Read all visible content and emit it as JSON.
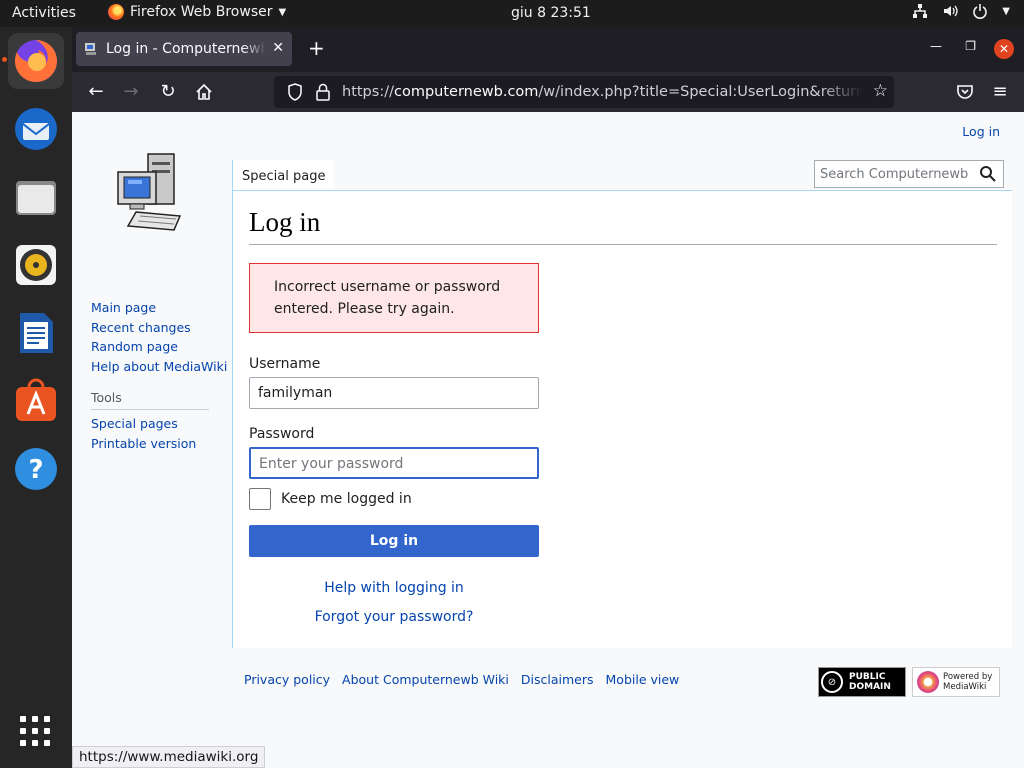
{
  "topbar": {
    "activities": "Activities",
    "app_name": "Firefox Web Browser",
    "clock": "giu 8  23:51"
  },
  "dock": {
    "items": [
      "firefox",
      "thunderbird",
      "files",
      "rhythmbox",
      "libreoffice-writer",
      "app-center",
      "help"
    ]
  },
  "browser": {
    "tab_title": "Log in - Computernewb Wiki",
    "url_domain": "computernewb.com",
    "url_prefix": "https://",
    "url_path": "/w/index.php?title=Special:UserLogin&returnto=Main+Page",
    "status_url": "https://www.mediawiki.org"
  },
  "page": {
    "login_link": "Log in",
    "special_tab": "Special page",
    "search_placeholder": "Search Computernewb Wiki",
    "heading": "Log in",
    "error_text": "Incorrect username or password entered. Please try again.",
    "username_label": "Username",
    "username_value": "familyman",
    "password_label": "Password",
    "password_placeholder": "Enter your password",
    "keep_logged_in": "Keep me logged in",
    "login_button": "Log in",
    "help_link": "Help with logging in",
    "forgot_link": "Forgot your password?"
  },
  "sidebar": {
    "nav": [
      "Main page",
      "Recent changes",
      "Random page",
      "Help about MediaWiki"
    ],
    "tools_heading": "Tools",
    "tools": [
      "Special pages",
      "Printable version"
    ]
  },
  "footer": {
    "links": [
      "Privacy policy",
      "About Computernewb Wiki",
      "Disclaimers",
      "Mobile view"
    ],
    "pd_badge_line1": "PUBLIC",
    "pd_badge_line2": "DOMAIN",
    "mw_badge_line1": "Powered by",
    "mw_badge_line2": "MediaWiki"
  },
  "colors": {
    "link": "#0645ad",
    "primary_button": "#3366cc",
    "error_bg": "#fee7e6",
    "error_border": "#dd3333"
  }
}
